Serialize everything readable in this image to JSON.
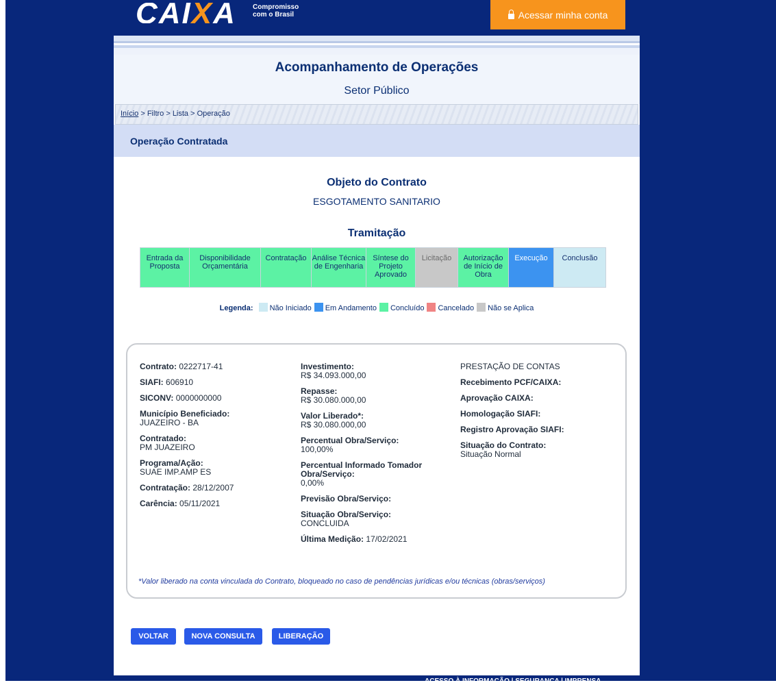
{
  "header": {
    "logo_prefix": "CAI",
    "logo_x": "X",
    "logo_suffix": "A",
    "tagline_1": "Compromisso",
    "tagline_2": "com o Brasil",
    "access_label": "Acessar minha conta",
    "accent": "#f7941d"
  },
  "page": {
    "title": "Acompanhamento de Operações",
    "subtitle": "Setor Público",
    "section": "Operação Contratada"
  },
  "breadcrumb": {
    "home": "Início",
    "rest": "> Filtro > Lista > Operação"
  },
  "objeto": {
    "title": "Objeto do Contrato",
    "value": "ESGOTAMENTO SANITARIO"
  },
  "tramitacao": {
    "title": "Tramitação",
    "steps": [
      {
        "label": "Entrada da Proposta",
        "status": "concluido"
      },
      {
        "label": "Disponibilidade Orçamentária",
        "status": "concluido"
      },
      {
        "label": "Contratação",
        "status": "concluido"
      },
      {
        "label": "Análise Técnica de Engenharia",
        "status": "concluido"
      },
      {
        "label": "Síntese do Projeto Aprovado",
        "status": "concluido"
      },
      {
        "label": "Licitação",
        "status": "nao_aplica"
      },
      {
        "label": "Autorização de Início de Obra",
        "status": "concluido"
      },
      {
        "label": "Execução",
        "status": "em_andamento"
      },
      {
        "label": "Conclusão",
        "status": "nao_iniciado"
      }
    ],
    "colors": {
      "nao_iniciado": "#cdeaf3",
      "em_andamento": "#3c93f0",
      "concluido": "#5cf2a4",
      "cancelado": "#f08484",
      "nao_aplica": "#c8c8c8"
    }
  },
  "legend": {
    "label": "Legenda:",
    "items": [
      {
        "label": "Não Iniciado",
        "color": "#cdeaf3"
      },
      {
        "label": "Em Andamento",
        "color": "#3c93f0"
      },
      {
        "label": "Concluído",
        "color": "#5cf2a4"
      },
      {
        "label": "Cancelado",
        "color": "#f08484"
      },
      {
        "label": "Não se Aplica",
        "color": "#c8c8c8"
      }
    ]
  },
  "details": {
    "col1": [
      {
        "label": "Contrato:",
        "value": "0222717-41",
        "inline": true
      },
      {
        "label": "SIAFI:",
        "value": "606910",
        "inline": true
      },
      {
        "label": "SICONV:",
        "value": "0000000000",
        "inline": true
      },
      {
        "label": "Município Beneficiado:",
        "value": "JUAZEIRO - BA",
        "inline": false
      },
      {
        "label": "Contratado:",
        "value": "PM JUAZEIRO",
        "inline": false
      },
      {
        "label": "Programa/Ação:",
        "value": "SUAE IMP.AMP ES",
        "inline": false
      },
      {
        "label": "Contratação:",
        "value": "28/12/2007",
        "inline": true
      },
      {
        "label": "Carência:",
        "value": "05/11/2021",
        "inline": true
      }
    ],
    "col2": [
      {
        "label": "Investimento:",
        "value": "R$ 34.093.000,00",
        "inline": false
      },
      {
        "label": "Repasse:",
        "value": "R$ 30.080.000,00",
        "inline": false
      },
      {
        "label": "Valor Liberado*:",
        "value": "R$ 30.080.000,00",
        "inline": false
      },
      {
        "label": "Percentual Obra/Serviço:",
        "value": "100,00%",
        "inline": false
      },
      {
        "label": "Percentual Informado Tomador Obra/Serviço:",
        "value": "0,00%",
        "inline": false
      },
      {
        "label": "Previsão Obra/Serviço:",
        "value": "",
        "inline": true
      },
      {
        "label": "Situação Obra/Serviço:",
        "value": "CONCLUIDA",
        "inline": false
      },
      {
        "label": "Última Medição:",
        "value": "17/02/2021",
        "inline": true
      }
    ],
    "col3_title": "PRESTAÇÃO DE CONTAS",
    "col3": [
      {
        "label": "Recebimento PCF/CAIXA:",
        "value": "",
        "inline": true
      },
      {
        "label": "Aprovação CAIXA:",
        "value": "",
        "inline": true
      },
      {
        "label": "Homologação SIAFI:",
        "value": "",
        "inline": true
      },
      {
        "label": "Registro Aprovação SIAFI:",
        "value": "",
        "inline": true
      },
      {
        "label": "Situação do Contrato:",
        "value": "Situação Normal",
        "inline": false
      }
    ],
    "note": "*Valor liberado na conta vinculada do Contrato, bloqueado no caso de pendências jurídicas e/ou técnicas (obras/serviços)"
  },
  "buttons": {
    "voltar": "VOLTAR",
    "nova": "NOVA CONSULTA",
    "liberacao": "LIBERAÇÃO"
  },
  "footer": {
    "text": "ACESSO À INFORMAÇÃO   |   SEGURANÇA   |   IMPRENSA"
  }
}
